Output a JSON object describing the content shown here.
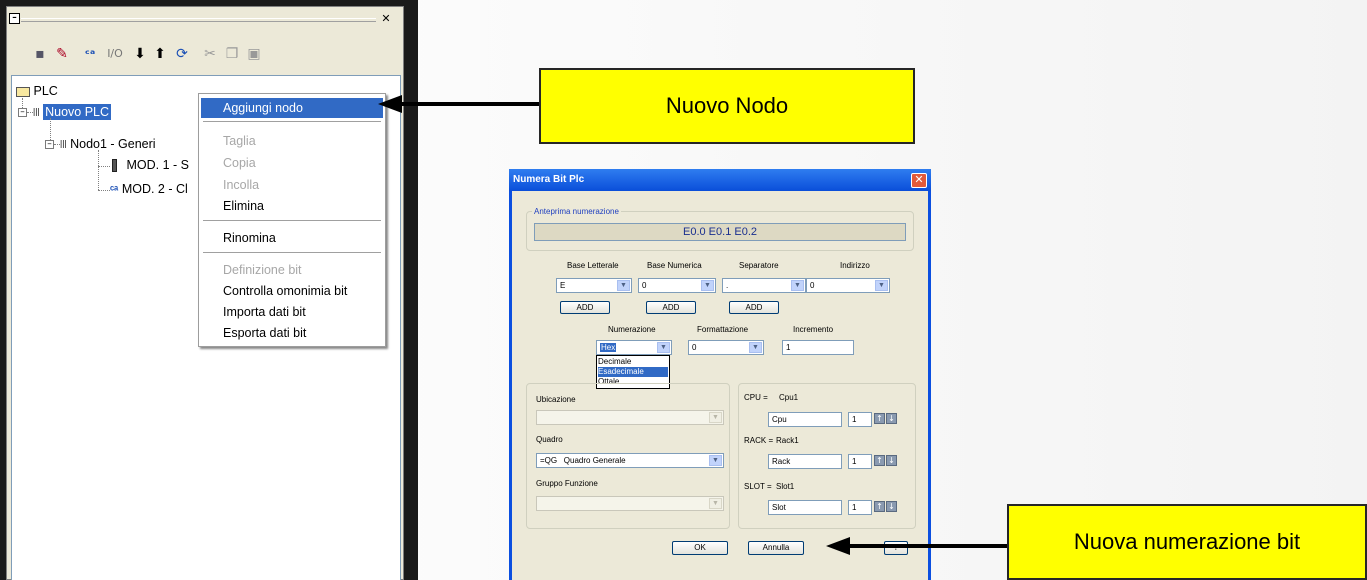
{
  "tree": {
    "root": "PLC",
    "plc": "Nuovo PLC",
    "node1": "Nodo1 - Generi",
    "mod1": "MOD. 1 - S",
    "mod2": "MOD. 2 - Cl",
    "hidden_glyph": "("
  },
  "toolbar": {
    "io_label": "I/O"
  },
  "context_menu": {
    "items": [
      {
        "label": "Aggiungi nodo",
        "state": "highlighted"
      },
      {
        "label": "Taglia",
        "state": "disabled"
      },
      {
        "label": "Copia",
        "state": "disabled"
      },
      {
        "label": "Incolla",
        "state": "disabled"
      },
      {
        "label": "Elimina",
        "state": "enabled"
      },
      {
        "label": "Rinomina",
        "state": "enabled"
      },
      {
        "label": "Definizione bit",
        "state": "disabled"
      },
      {
        "label": "Controlla omonimia bit",
        "state": "enabled"
      },
      {
        "label": "Importa dati bit",
        "state": "enabled"
      },
      {
        "label": "Esporta dati bit",
        "state": "enabled"
      }
    ]
  },
  "callouts": {
    "nuovo_nodo": "Nuovo Nodo",
    "nuova_numerazione": "Nuova numerazione bit"
  },
  "dialog": {
    "title": "Numera Bit Plc",
    "preview_group": "Anteprima numerazione",
    "preview_value": "E0.0  E0.1  E0.2",
    "labels": {
      "base_letterale": "Base Letterale",
      "base_numerica": "Base Numerica",
      "separatore": "Separatore",
      "indirizzo": "Indirizzo",
      "numerazione": "Numerazione",
      "formattazione": "Formattazione",
      "incremento": "Incremento",
      "ubicazione": "Ubicazione",
      "quadro": "Quadro",
      "gruppo_funzione": "Gruppo Funzione"
    },
    "values": {
      "base_letterale": "E",
      "base_numerica": "0",
      "separatore": ".",
      "indirizzo": "0",
      "numerazione": "Hex",
      "formattazione": "0",
      "incremento": "1",
      "quadro": "=QG   Quadro Generale"
    },
    "add_label": "ADD",
    "numerazione_options": [
      "Decimale",
      "Esadecimale",
      "Ottale"
    ],
    "numerazione_selected_index": 1,
    "cpu": {
      "label": "CPU =",
      "name": "Cpu1",
      "field": "Cpu",
      "count": "1"
    },
    "rack": {
      "label": "RACK =",
      "name": "Rack1",
      "field": "Rack",
      "count": "1"
    },
    "slot": {
      "label": "SLOT =",
      "name": "Slot1",
      "field": "Slot",
      "count": "1"
    },
    "ok_label": "OK",
    "cancel_label": "Annulla",
    "help_label": "?"
  },
  "colors": {
    "callout_fill": "#ffff00",
    "selection": "#316ac5",
    "dialog_title": "#0b4fe0"
  }
}
